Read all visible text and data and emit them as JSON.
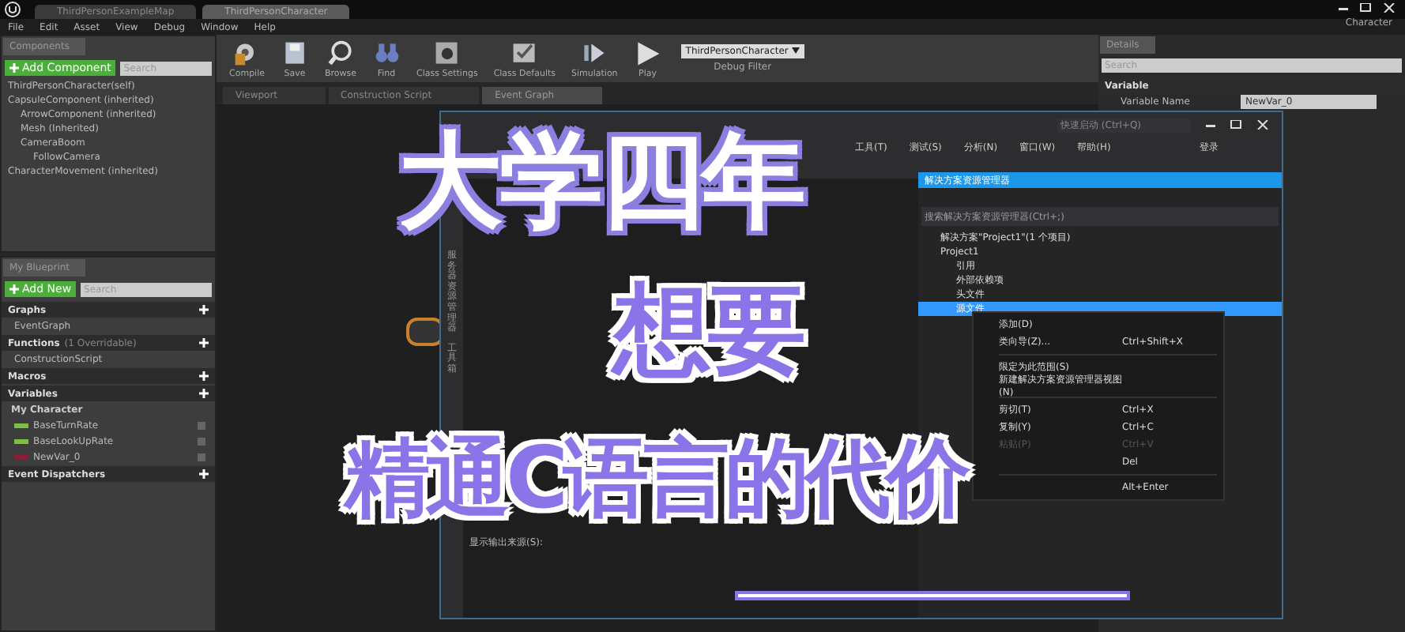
{
  "ue_editor": {
    "doc_tabs": [
      {
        "label": "ThirdPersonExampleMap",
        "selected": false
      },
      {
        "label": "ThirdPersonCharacter",
        "selected": true
      }
    ],
    "menu": [
      "File",
      "Edit",
      "Asset",
      "View",
      "Debug",
      "Window",
      "Help"
    ],
    "profile_label": "Character",
    "components_panel": {
      "tab": "Components",
      "add_button": "Add Component",
      "search_placeholder": "Search",
      "tree": [
        {
          "label": "ThirdPersonCharacter(self)"
        },
        {
          "label": "CapsuleComponent (inherited)",
          "children": [
            {
              "label": "ArrowComponent (inherited)"
            },
            {
              "label": "Mesh (Inherited)"
            },
            {
              "label": "CameraBoom",
              "children": [
                {
                  "label": "FollowCamera"
                }
              ]
            }
          ]
        },
        {
          "label": "CharacterMovement (inherited)"
        }
      ]
    },
    "blueprint_panel": {
      "tab": "My Blueprint",
      "add_button": "Add New",
      "search_placeholder": "Search",
      "sections": [
        {
          "kind": "list",
          "title": "Graphs",
          "items": [
            "EventGraph"
          ]
        },
        {
          "kind": "list",
          "title": "Functions",
          "note": "(1 Overridable)",
          "items": [
            "ConstructionScript"
          ]
        },
        {
          "kind": "list",
          "title": "Macros"
        },
        {
          "kind": "variables",
          "title": "Variables",
          "group": "My Character",
          "variables": [
            {
              "name": "BaseTurnRate",
              "color": "#7bc043"
            },
            {
              "name": "BaseLookUpRate",
              "color": "#7bc043"
            },
            {
              "name": "NewVar_0",
              "color": "#8a1f33"
            }
          ]
        },
        {
          "kind": "list",
          "title": "Event Dispatchers"
        }
      ]
    },
    "toolbar": [
      "Compile",
      "Save",
      "Browse",
      "Find",
      "Class Settings",
      "Class Defaults",
      "Simulation",
      "Play"
    ],
    "debug_object": "ThirdPersonCharacter",
    "debug_label": "Debug Filter",
    "editor_tabs": [
      {
        "label": "Viewport",
        "selected": false
      },
      {
        "label": "Construction Script",
        "selected": false
      },
      {
        "label": "Event Graph",
        "selected": true
      }
    ],
    "details_panel": {
      "tab": "Details",
      "search_placeholder": "Search",
      "section": "Variable",
      "rows": [
        {
          "label": "Variable Name",
          "value": "NewVar_0"
        }
      ]
    }
  },
  "vs_window": {
    "quick_launch_placeholder": "快速启动 (Ctrl+Q)",
    "menu": [
      "工具(T)",
      "测试(S)",
      "分析(N)",
      "窗口(W)",
      "帮助(H)"
    ],
    "sign_in": "登录",
    "side_tabs": [
      "服务器资源管理器",
      "工具箱"
    ],
    "output_label": "显示输出来源(S):",
    "solution_explorer": {
      "title": "解决方案资源管理器",
      "search_placeholder": "搜索解决方案资源管理器(Ctrl+;)",
      "tree": [
        {
          "label": "解决方案\"Project1\"(1 个项目)",
          "selected": false
        },
        {
          "label": "Project1",
          "selected": false,
          "children": [
            {
              "label": "引用",
              "selected": false
            },
            {
              "label": "外部依赖项",
              "selected": false
            },
            {
              "label": "头文件",
              "selected": false
            },
            {
              "label": "源文件",
              "selected": true
            }
          ]
        }
      ]
    },
    "context_menu": [
      {
        "kind": "item",
        "label": "添加(D)",
        "disabled": false
      },
      {
        "kind": "item",
        "label": "类向导(Z)...",
        "shortcut": "Ctrl+Shift+X",
        "disabled": false
      },
      {
        "kind": "separator"
      },
      {
        "kind": "item",
        "label": "限定为此范围(S)",
        "disabled": false
      },
      {
        "kind": "item",
        "label": "新建解决方案资源管理器视图(N)",
        "disabled": false
      },
      {
        "kind": "separator"
      },
      {
        "kind": "item",
        "label": "剪切(T)",
        "shortcut": "Ctrl+X",
        "disabled": false
      },
      {
        "kind": "item",
        "label": "复制(Y)",
        "shortcut": "Ctrl+C",
        "disabled": false
      },
      {
        "kind": "item",
        "label": "粘贴(P)",
        "shortcut": "Ctrl+V",
        "disabled": true
      },
      {
        "kind": "item",
        "shortcut": "Del",
        "disabled": false
      },
      {
        "kind": "separator"
      },
      {
        "kind": "item",
        "shortcut": "Alt+Enter",
        "disabled": false
      }
    ]
  },
  "captions": [
    {
      "kind": "outline",
      "text": "大学四年"
    },
    {
      "kind": "filled",
      "text": "想要"
    },
    {
      "kind": "filled",
      "text": "精通C语言的代价"
    }
  ]
}
